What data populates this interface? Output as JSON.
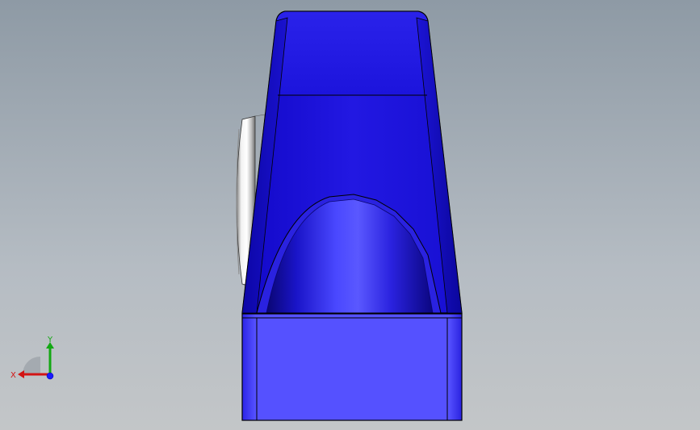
{
  "viewport": {
    "background_top": "#8e9aa5",
    "background_bottom": "#c3c6c8"
  },
  "model": {
    "body_color": "#1b16d6",
    "base_front_color": "#5551ff",
    "bearing_color": "#d9d9d9",
    "edge_color": "#000000"
  },
  "triad": {
    "x_label": "X",
    "y_label": "Y",
    "x_color": "#d21414",
    "y_color": "#13a813",
    "z_color": "#1a1aff"
  }
}
